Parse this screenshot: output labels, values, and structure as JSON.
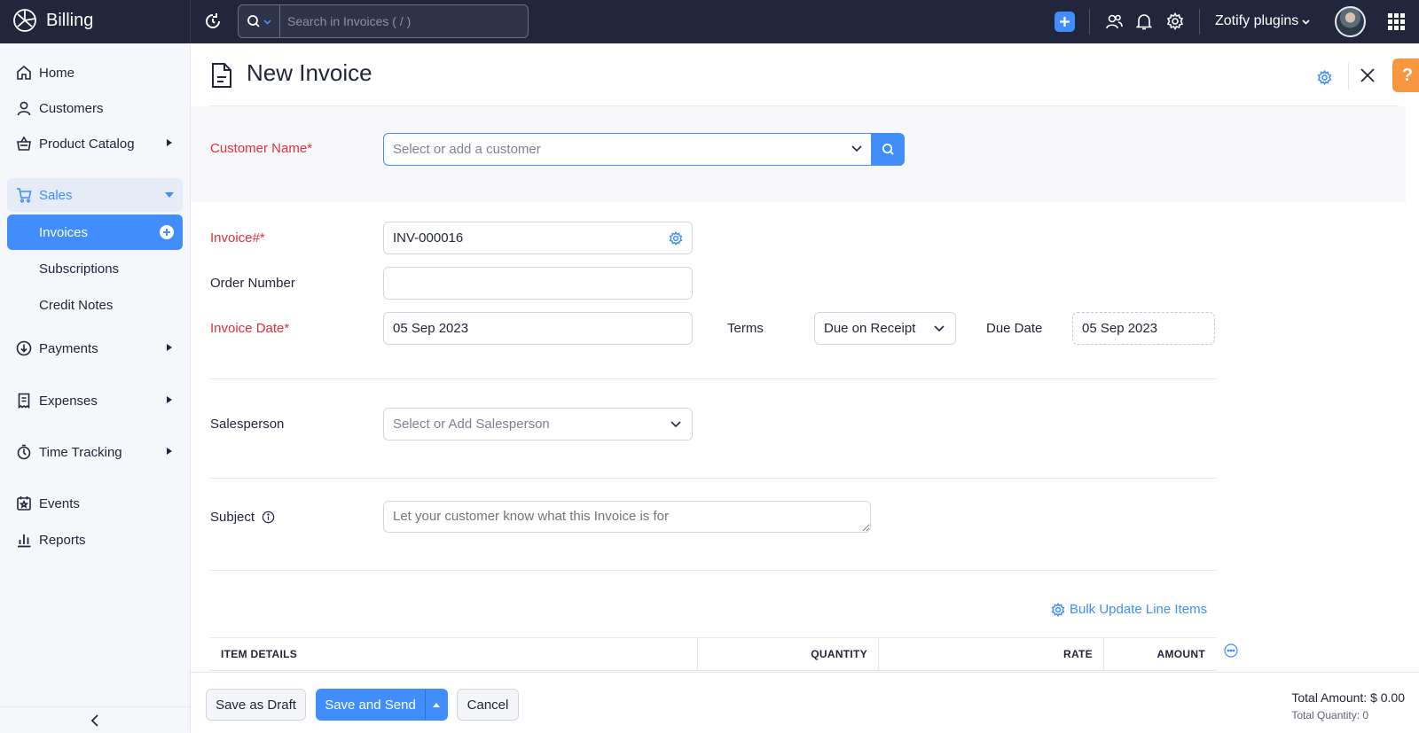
{
  "app": {
    "name": "Billing",
    "org_name": "Zotify plugins"
  },
  "search": {
    "placeholder": "Search in Invoices ( / )"
  },
  "sidebar": {
    "items": [
      {
        "label": "Home",
        "icon": "home-icon"
      },
      {
        "label": "Customers",
        "icon": "user-icon"
      },
      {
        "label": "Product Catalog",
        "icon": "basket-icon"
      },
      {
        "label": "Sales",
        "icon": "cart-icon"
      },
      {
        "label": "Payments",
        "icon": "payment-icon"
      },
      {
        "label": "Expenses",
        "icon": "receipt-icon"
      },
      {
        "label": "Time Tracking",
        "icon": "stopwatch-icon"
      },
      {
        "label": "Events",
        "icon": "event-icon"
      },
      {
        "label": "Reports",
        "icon": "bar-chart-icon"
      }
    ],
    "sales_sub": [
      {
        "label": "Invoices",
        "active": true
      },
      {
        "label": "Subscriptions"
      },
      {
        "label": "Credit Notes"
      }
    ]
  },
  "page": {
    "title": "New Invoice"
  },
  "form": {
    "customer_label": "Customer Name*",
    "customer_placeholder": "Select or add a customer",
    "invoice_number_label": "Invoice#*",
    "invoice_number_value": "INV-000016",
    "order_number_label": "Order Number",
    "order_number_value": "",
    "invoice_date_label": "Invoice Date*",
    "invoice_date_value": "05 Sep 2023",
    "terms_label": "Terms",
    "terms_value": "Due on Receipt",
    "due_date_label": "Due Date",
    "due_date_value": "05 Sep 2023",
    "salesperson_label": "Salesperson",
    "salesperson_placeholder": "Select or Add Salesperson",
    "subject_label": "Subject",
    "subject_placeholder": "Let your customer know what this Invoice is for"
  },
  "items": {
    "bulk_update_label": "Bulk Update Line Items",
    "columns": [
      "ITEM DETAILS",
      "QUANTITY",
      "RATE",
      "AMOUNT"
    ]
  },
  "footer": {
    "save_draft": "Save as Draft",
    "save_send": "Save and Send",
    "cancel": "Cancel",
    "total_amount": "Total Amount: $ 0.00",
    "total_quantity": "Total Quantity: 0"
  },
  "colors": {
    "accent": "#408dfb",
    "topbar": "#21263c",
    "required": "#e0303a",
    "help": "#f8973f"
  }
}
